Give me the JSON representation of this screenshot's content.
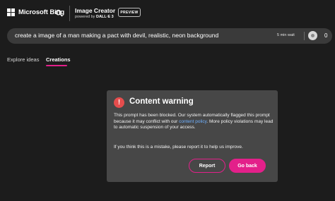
{
  "header": {
    "logo_text": "Microsoft Bing",
    "app_title": "Image Creator",
    "powered_by_prefix": "powered by",
    "powered_by_model": "DALL·E 3",
    "badge": "PREVIEW"
  },
  "prompt": {
    "text": "create a image of a man making a pact with devil, realistic, neon background",
    "wait": "5 min wait",
    "boost_count": "0"
  },
  "tabs": [
    {
      "label": "Explore ideas",
      "active": false
    },
    {
      "label": "Creations",
      "active": true
    }
  ],
  "dialog": {
    "title": "Content warning",
    "icon": "exclamation-icon",
    "body_before_link": "This prompt has been blocked. Our system automatically flagged this prompt because it may conflict with our ",
    "link_text": "content policy",
    "body_after_link": ". More policy violations may lead to automatic suspension of your access.",
    "body2": "If you think this is a mistake, please report it to help us improve.",
    "report_label": "Report",
    "back_label": "Go back"
  },
  "colors": {
    "background": "#1c1c1c",
    "accent": "#e3208a",
    "dialog": "#474747",
    "warning": "#e64d4d",
    "link": "#6fb0ff"
  }
}
